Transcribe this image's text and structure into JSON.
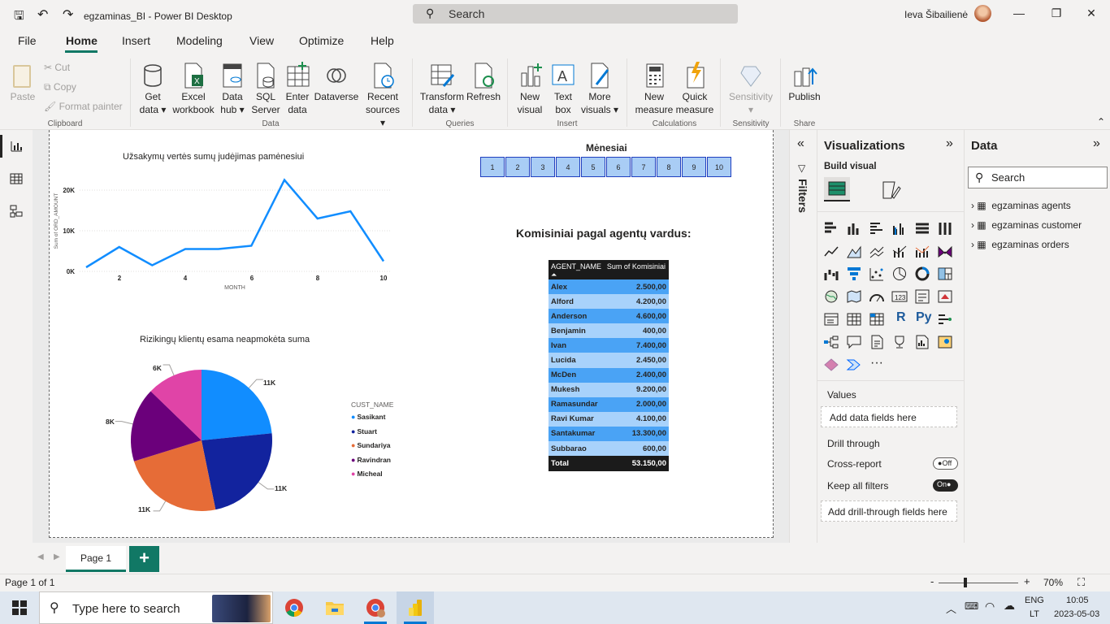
{
  "app": {
    "title": "egzaminas_BI - Power BI Desktop",
    "search_label": "Search",
    "user_name": "Ieva Šibailienė"
  },
  "menu": [
    "File",
    "Home",
    "Insert",
    "Modeling",
    "View",
    "Optimize",
    "Help"
  ],
  "ribbon": {
    "clipboard": {
      "paste": "Paste",
      "cut": "Cut",
      "copy": "Copy",
      "format_painter": "Format painter",
      "group": "Clipboard"
    },
    "data": {
      "get_data": [
        "Get",
        "data"
      ],
      "excel": [
        "Excel",
        "workbook"
      ],
      "data_hub": [
        "Data",
        "hub"
      ],
      "sql": [
        "SQL",
        "Server"
      ],
      "enter": [
        "Enter",
        "data"
      ],
      "dataverse": "Dataverse",
      "recent": [
        "Recent",
        "sources"
      ],
      "group": "Data"
    },
    "queries": {
      "transform": [
        "Transform",
        "data"
      ],
      "refresh": "Refresh",
      "group": "Queries"
    },
    "insert": {
      "new_visual": [
        "New",
        "visual"
      ],
      "text_box": [
        "Text",
        "box"
      ],
      "more_visuals": [
        "More",
        "visuals"
      ],
      "group": "Insert"
    },
    "calculations": {
      "new_measure": [
        "New",
        "measure"
      ],
      "quick_measure": [
        "Quick",
        "measure"
      ],
      "group": "Calculations"
    },
    "sensitivity": {
      "label": "Sensitivity",
      "group": "Sensitivity"
    },
    "share": {
      "publish": "Publish",
      "group": "Share"
    }
  },
  "line_chart": {
    "title": "Užsakymų vertės sumų judėjimas pamėnesiui",
    "xlabel": "MONTH",
    "ylabel": "Sum of ORD_AMOUNT",
    "y_ticks": [
      "0K",
      "10K",
      "20K"
    ],
    "x_ticks": [
      "2",
      "4",
      "6",
      "8",
      "10"
    ]
  },
  "pie_chart": {
    "title": "Rizikingų klientų esama neapmokėta suma",
    "legend_title": "CUST_NAME",
    "data_labels": [
      "11K",
      "11K",
      "11K",
      "8K",
      "6K"
    ]
  },
  "chart_data": [
    {
      "type": "line",
      "title": "Užsakymų vertės sumų judėjimas pamėnesiui",
      "xlabel": "MONTH",
      "ylabel": "Sum of ORD_AMOUNT",
      "x": [
        1,
        2,
        3,
        4,
        5,
        6,
        7,
        8,
        9,
        10
      ],
      "values": [
        1000,
        6000,
        1500,
        5500,
        5500,
        6300,
        22500,
        13000,
        14800,
        2500
      ],
      "xlim": [
        1,
        10
      ],
      "ylim": [
        0,
        25000
      ],
      "color": "#118dff"
    },
    {
      "type": "pie",
      "title": "Rizikingų klientų esama neapmokėta suma",
      "legend_title": "CUST_NAME",
      "categories": [
        "Sasikant",
        "Stuart",
        "Sundariya",
        "Ravindran",
        "Micheal"
      ],
      "values": [
        11000,
        11000,
        11000,
        8000,
        6000
      ],
      "colors": [
        "#118dff",
        "#12239e",
        "#e66c37",
        "#6b007b",
        "#e044a7"
      ]
    }
  ],
  "slicer": {
    "title": "Mėnesiai",
    "values": [
      "1",
      "2",
      "3",
      "4",
      "5",
      "6",
      "7",
      "8",
      "9",
      "10"
    ]
  },
  "table": {
    "title": "Komisiniai pagal agentų vardus:",
    "headers": [
      "AGENT_NAME",
      "Sum of Komisiniai"
    ],
    "rows": [
      [
        "Alex",
        "2.500,00"
      ],
      [
        "Alford",
        "4.200,00"
      ],
      [
        "Anderson",
        "4.600,00"
      ],
      [
        "Benjamin",
        "400,00"
      ],
      [
        "Ivan",
        "7.400,00"
      ],
      [
        "Lucida",
        "2.450,00"
      ],
      [
        "McDen",
        "2.400,00"
      ],
      [
        "Mukesh",
        "9.200,00"
      ],
      [
        "Ramasundar",
        "2.000,00"
      ],
      [
        "Ravi Kumar",
        "4.100,00"
      ],
      [
        "Santakumar",
        "13.300,00"
      ],
      [
        "Subbarao",
        "600,00"
      ]
    ],
    "total": [
      "Total",
      "53.150,00"
    ]
  },
  "filters": {
    "label": "Filters"
  },
  "viz_pane": {
    "title": "Visualizations",
    "build_visual": "Build visual",
    "values_label": "Values",
    "values_placeholder": "Add data fields here",
    "drill_through": "Drill through",
    "cross_report": "Cross-report",
    "cross_report_state": "Off",
    "keep_filters": "Keep all filters",
    "keep_filters_state": "On",
    "drill_placeholder": "Add drill-through fields here",
    "r_icon": "R",
    "py_icon": "Py",
    "more": "···"
  },
  "data_pane": {
    "title": "Data",
    "search_placeholder": "Search",
    "tables": [
      "egzaminas agents",
      "egzaminas customer",
      "egzaminas orders"
    ]
  },
  "pages": {
    "tab": "Page 1",
    "add": "+"
  },
  "status": {
    "page_info": "Page 1 of 1",
    "zoom": "70%",
    "minus": "-",
    "plus": "+"
  },
  "taskbar": {
    "search": "Type here to search",
    "lang": [
      "ENG",
      "LT"
    ],
    "time": "10:05",
    "date": "2023-05-03"
  }
}
